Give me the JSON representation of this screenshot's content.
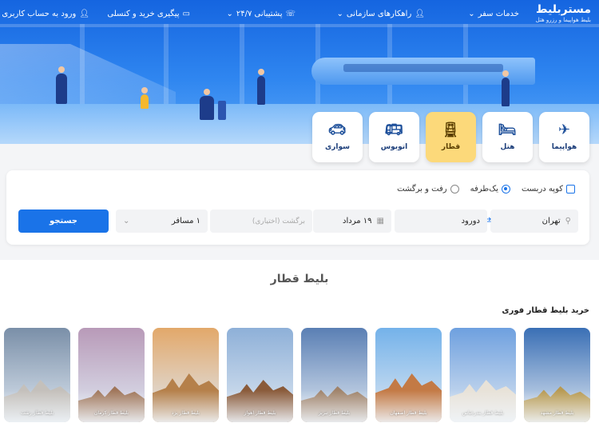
{
  "brand": {
    "name": "مستربلیط",
    "tagline": "بلیط هواپیما و رزرو هتل"
  },
  "nav": {
    "travel_services": "خدمات سفر",
    "org_solutions": "راهکارهای سازمانی",
    "support": "پشتیبانی ۲۴/۷",
    "tracking": "پیگیری خرید و کنسلی",
    "login": "ورود به حساب کاربری"
  },
  "tabs": [
    {
      "label": "هواپیما",
      "icon": "airplane-icon",
      "active": false
    },
    {
      "label": "هتل",
      "icon": "bed-icon",
      "active": false
    },
    {
      "label": "قطار",
      "icon": "train-icon",
      "active": true
    },
    {
      "label": "اتوبوس",
      "icon": "bus-icon",
      "active": false
    },
    {
      "label": "سواری",
      "icon": "car-icon",
      "active": false
    }
  ],
  "search": {
    "coupe": "کوپه دربست",
    "one_way": "یک‌طرفه",
    "round_trip": "رفت و برگشت",
    "origin": "تهران",
    "destination": "دورود",
    "depart_date": "۱۹ مرداد",
    "return_placeholder": "برگشت (اختیاری)",
    "passengers": "۱ مسافر",
    "submit": "جستجو"
  },
  "section_title": "بلیط قطار",
  "quick_title": "خرید بلیط قطار فوری",
  "cities": [
    {
      "label": "بلیط قطار مشهد",
      "sky": "#3a6fb5",
      "ground": "#b89a52"
    },
    {
      "label": "بلیط قطار بندرعباس",
      "sky": "#6ea0df",
      "ground": "#e8e2d8"
    },
    {
      "label": "بلیط قطار اصفهان",
      "sky": "#74b2ea",
      "ground": "#c37a45"
    },
    {
      "label": "بلیط قطار تبریز",
      "sky": "#5a7fb4",
      "ground": "#a0836a"
    },
    {
      "label": "بلیط قطار اهواز",
      "sky": "#8eb0d8",
      "ground": "#8a5b3a"
    },
    {
      "label": "بلیط قطار یزد",
      "sky": "#e2a86a",
      "ground": "#b5804a"
    },
    {
      "label": "بلیط قطار کرمان",
      "sky": "#b89ab8",
      "ground": "#a0765a"
    },
    {
      "label": "بلیط قطار رشت",
      "sky": "#7a8fa8",
      "ground": "#c4c0bb"
    }
  ],
  "colors": {
    "primary": "#1a73e8",
    "active_tab": "#fcd97a"
  }
}
